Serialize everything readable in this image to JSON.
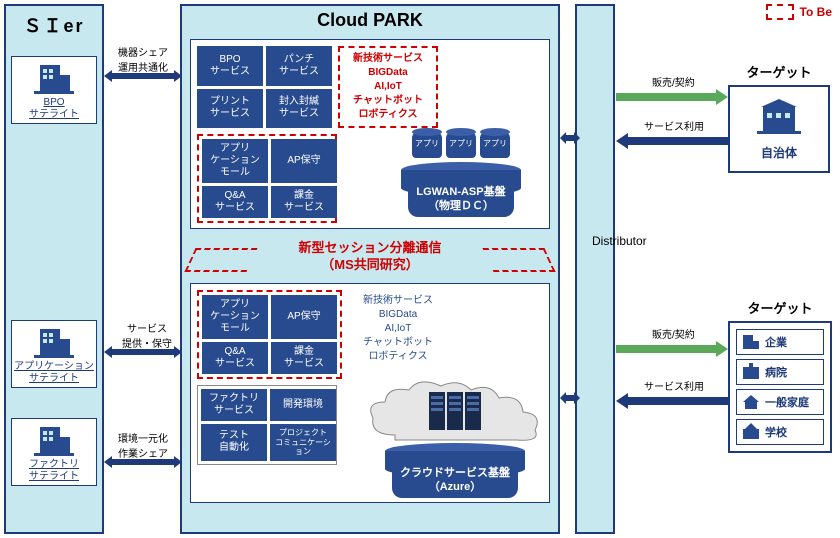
{
  "legend": {
    "tobe": "To Be"
  },
  "sier": {
    "title": "ＳＩer",
    "satellites": [
      {
        "label": "BPO\nサテライト",
        "conn_label": "機器シェア\n運用共通化"
      },
      {
        "label": "アプリケーション\nサテライト",
        "conn_label": "サービス\n提供・保守"
      },
      {
        "label": "ファクトリ\nサテライト",
        "conn_label": "環境一元化\n作業シェア"
      }
    ]
  },
  "cloud": {
    "title": "Cloud PARK",
    "upper": {
      "grid1": [
        "BPO\nサービス",
        "パンチ\nサービス",
        "プリント\nサービス",
        "封入封緘\nサービス"
      ],
      "tech": {
        "title": "新技術サービス",
        "lines": [
          "BIGData",
          "AI,IoT",
          "チャットボット",
          "ロボティクス"
        ]
      },
      "grid2": [
        "アプリ\nケーション\nモール",
        "AP保守",
        "Q&A\nサービス",
        "課金\nサービス"
      ],
      "platform": "LGWAN-ASP基盤\n（物理ＤＣ）",
      "app_labels": [
        "アプリ",
        "アプリ",
        "アプリ"
      ]
    },
    "session": "新型セッション分離通信\n（MS共同研究）",
    "lower": {
      "grid1": [
        "アプリ\nケーション\nモール",
        "AP保守",
        "Q&A\nサービス",
        "課金\nサービス"
      ],
      "tech": {
        "title": "新技術サービス",
        "lines": [
          "BIGData",
          "AI,IoT",
          "チャットボット",
          "ロボティクス"
        ]
      },
      "grid2": [
        "ファクトリ\nサービス",
        "開発環境",
        "テスト\n自動化",
        "プロジェクト\nコミュニケーション"
      ],
      "platform": "クラウドサービス基盤\n（Azure）"
    }
  },
  "distributor": "Distributor",
  "targets": {
    "upper": {
      "title": "ターゲット",
      "items": [
        "自治体"
      ]
    },
    "lower": {
      "title": "ターゲット",
      "items": [
        "企業",
        "病院",
        "一般家庭",
        "学校"
      ]
    }
  },
  "flows": {
    "sell": "販売/契約",
    "use": "サービス利用"
  }
}
